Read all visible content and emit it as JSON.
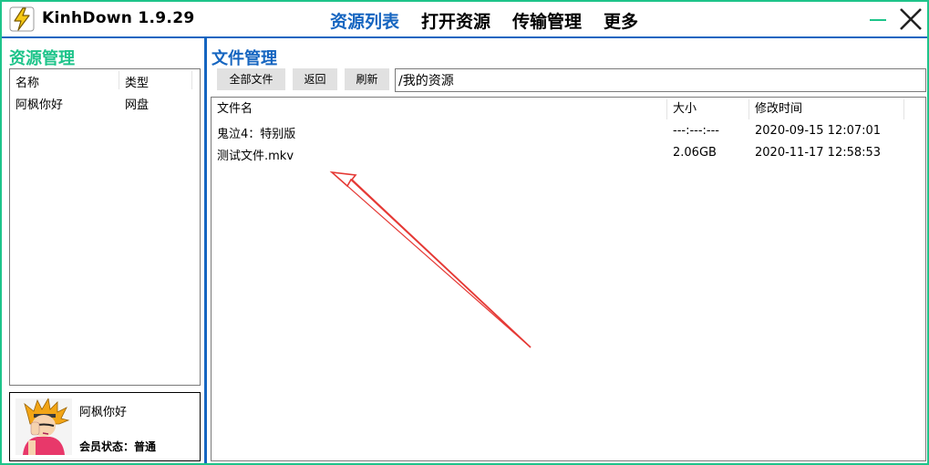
{
  "titlebar": {
    "app_name": "KinhDown 1.9.29",
    "nav": [
      "资源列表",
      "打开资源",
      "传输管理",
      "更多"
    ],
    "active_nav": 0,
    "accent_green": "#1ec48a",
    "accent_blue": "#1565c0"
  },
  "left_panel": {
    "title": "资源管理",
    "table": {
      "headers": [
        "名称",
        "类型"
      ],
      "rows": [
        {
          "name": "阿枫你好",
          "type": "网盘"
        }
      ]
    },
    "user": {
      "name": "阿枫你好",
      "status_label": "会员状态：",
      "status_value": "普通"
    }
  },
  "right_panel": {
    "title": "文件管理",
    "buttons": {
      "all_files": "全部文件",
      "back": "返回",
      "refresh": "刷新"
    },
    "path": "/我的资源",
    "table": {
      "headers": [
        "文件名",
        "大小",
        "修改时间"
      ],
      "rows": [
        {
          "name": "鬼泣4：特别版",
          "size": "---:---:---",
          "modified": "2020-09-15 12:07:01"
        },
        {
          "name": "测试文件.mkv",
          "size": "2.06GB",
          "modified": "2020-11-17 12:58:53"
        }
      ]
    }
  },
  "annotation_color": "#e53935"
}
